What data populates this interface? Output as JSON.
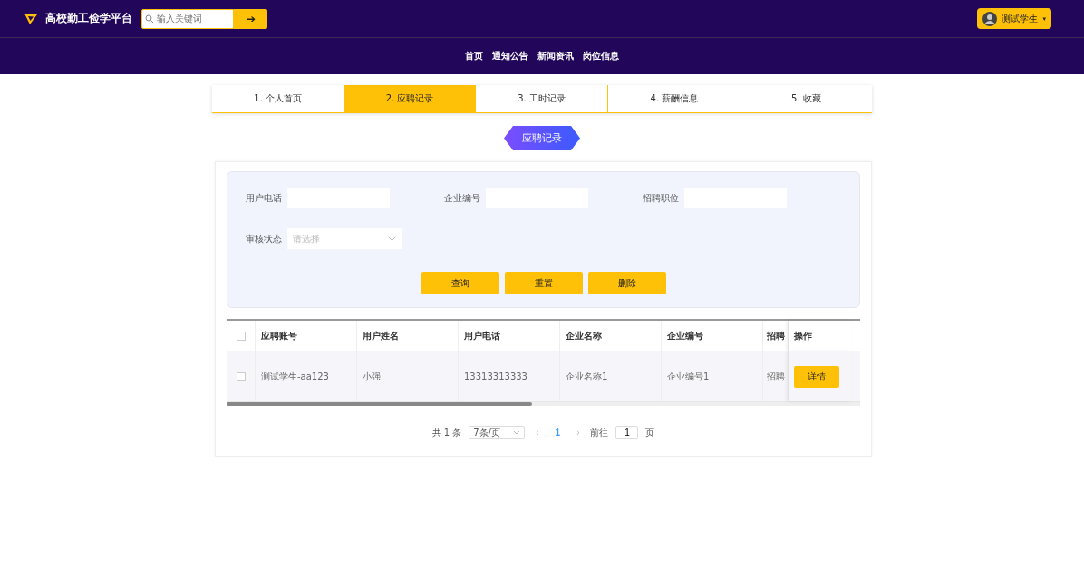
{
  "header": {
    "logo": "高校勤工俭学平台",
    "search": {
      "placeholder": "输入关键词",
      "button": "➔"
    },
    "user": {
      "name": "测试学生",
      "caret": "▾"
    }
  },
  "nav": [
    {
      "label": "首页"
    },
    {
      "label": "通知公告"
    },
    {
      "label": "新闻资讯"
    },
    {
      "label": "岗位信息"
    }
  ],
  "tabs": [
    {
      "label": "1. 个人首页",
      "selected": false
    },
    {
      "label": "2. 应聘记录",
      "selected": true
    },
    {
      "label": "3. 工时记录",
      "selected": false
    },
    {
      "label": "4. 薪酬信息",
      "selected": false
    },
    {
      "label": "5. 收藏",
      "selected": false
    }
  ],
  "page_title": "应聘记录",
  "filters": [
    {
      "label": "用户电话",
      "kind": "input"
    },
    {
      "label": "企业编号",
      "kind": "input"
    },
    {
      "label": "招聘职位",
      "kind": "input"
    },
    {
      "label": "审核状态",
      "kind": "select",
      "placeholder": "请选择"
    }
  ],
  "actions": [
    "查询",
    "重置",
    "删除"
  ],
  "table": {
    "columns": [
      "应聘账号",
      "用户姓名",
      "用户电话",
      "企业名称",
      "企业编号",
      "招聘"
    ],
    "action_column": "操作",
    "rows": [
      {
        "checked": false,
        "cells": [
          "测试学生-aa123",
          "小强",
          "13313313333",
          "企业名称1",
          "企业编号1",
          "招聘"
        ],
        "action": "详情"
      }
    ],
    "header_checked": false
  },
  "pagination": {
    "total": "共 1 条",
    "page_size": "7条/页",
    "prev": "‹",
    "pages": [
      {
        "label": "1",
        "selected": true
      }
    ],
    "next": "›",
    "goto": "前往",
    "goto_value": "1",
    "page_unit": "页"
  }
}
